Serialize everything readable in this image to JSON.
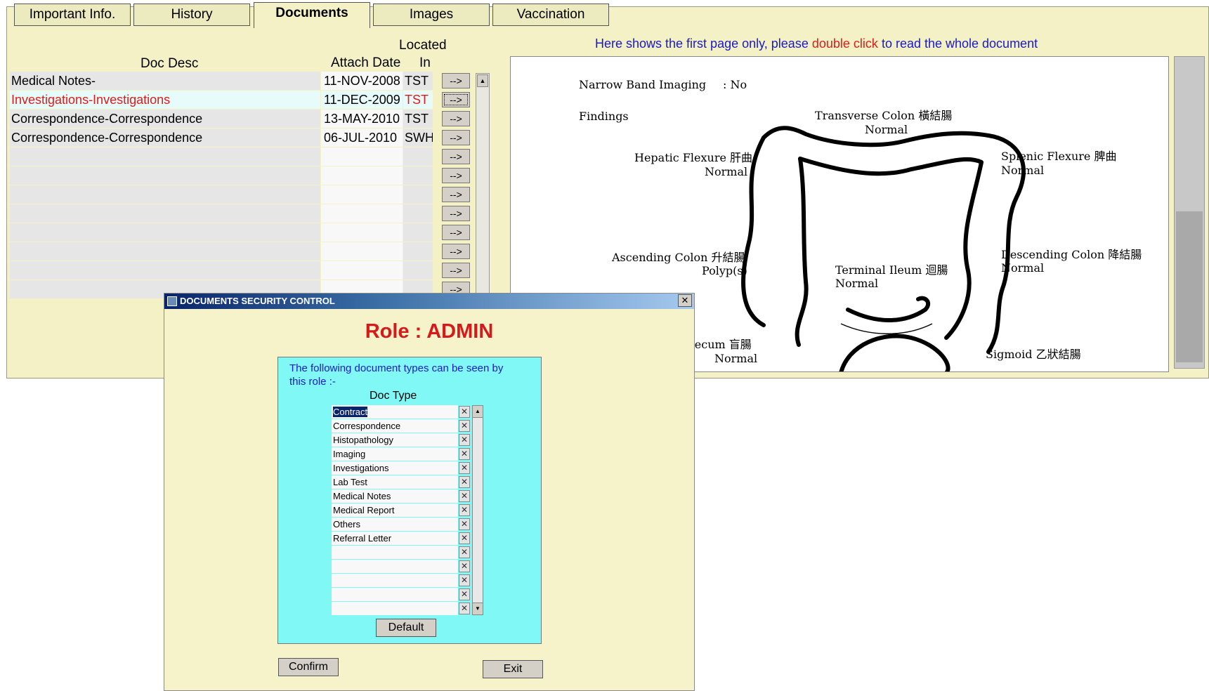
{
  "tabs": [
    "Important Info.",
    "History",
    "Documents",
    "Images",
    "Vaccination"
  ],
  "documents": {
    "headers": {
      "desc": "Doc Desc",
      "date": "Attach Date",
      "located_top": "Located",
      "located_bottom": "In"
    },
    "rows": [
      {
        "desc": "Medical Notes-",
        "date": "11-NOV-2008",
        "loc": "TST",
        "btn": "-->"
      },
      {
        "desc": "Investigations-Investigations",
        "date": "11-DEC-2009",
        "loc": "TST",
        "btn": "-->"
      },
      {
        "desc": "Correspondence-Correspondence",
        "date": "13-MAY-2010",
        "loc": "TST",
        "btn": "-->"
      },
      {
        "desc": "Correspondence-Correspondence",
        "date": "06-JUL-2010",
        "loc": "SWH",
        "btn": "-->"
      },
      {
        "desc": "",
        "date": "",
        "loc": "",
        "btn": "-->"
      },
      {
        "desc": "",
        "date": "",
        "loc": "",
        "btn": "-->"
      },
      {
        "desc": "",
        "date": "",
        "loc": "",
        "btn": "-->"
      },
      {
        "desc": "",
        "date": "",
        "loc": "",
        "btn": "-->"
      },
      {
        "desc": "",
        "date": "",
        "loc": "",
        "btn": "-->"
      },
      {
        "desc": "",
        "date": "",
        "loc": "",
        "btn": "-->"
      },
      {
        "desc": "",
        "date": "",
        "loc": "",
        "btn": "-->"
      },
      {
        "desc": "",
        "date": "",
        "loc": "",
        "btn": "-->"
      }
    ]
  },
  "preview": {
    "notice_part1": "Here shows the first page only, please",
    "notice_red": "double click",
    "notice_part2": "to read the whole document",
    "lines": {
      "nbi_label": "Narrow Band Imaging",
      "nbi_value": ": No",
      "findings": "Findings",
      "transverse": "Transverse Colon 橫結腸",
      "transverse_status": "Normal",
      "hepatic": "Hepatic Flexure 肝曲",
      "hepatic_status": "Normal",
      "splenic": "Splenic Flexure 脾曲",
      "splenic_status": "Normal",
      "ascending": "Ascending Colon 升結腸",
      "ascending_status": "Polyp(s)",
      "terminal": "Terminal Ileum 迴腸",
      "terminal_status": "Normal",
      "descending": "Descending Colon 降結腸",
      "descending_status": "Normal",
      "caecum": "Caecum 盲腸",
      "caecum_status": "Normal",
      "sigmoid": "Sigmoid 乙狀結腸"
    }
  },
  "dialog": {
    "title": "DOCUMENTS SECURITY CONTROL",
    "close": "✕",
    "role": "Role : ADMIN",
    "intro": "The following document types can be seen by this role :-",
    "column": "Doc Type",
    "doc_types": [
      "Contract",
      "Correspondence",
      "Histopathology",
      "Imaging",
      "Investigations",
      "Lab Test",
      "Medical Notes",
      "Medical Report",
      "Others",
      "Referral Letter",
      "",
      "",
      "",
      "",
      ""
    ],
    "default_label": "Default",
    "confirm_label": "Confirm",
    "exit_label": "Exit"
  },
  "colors": {
    "main_bg": "#f3f1c5",
    "dialog_panel": "#80f8f6",
    "role_red": "#d41a1a",
    "link_blue": "#1a1ac8"
  }
}
